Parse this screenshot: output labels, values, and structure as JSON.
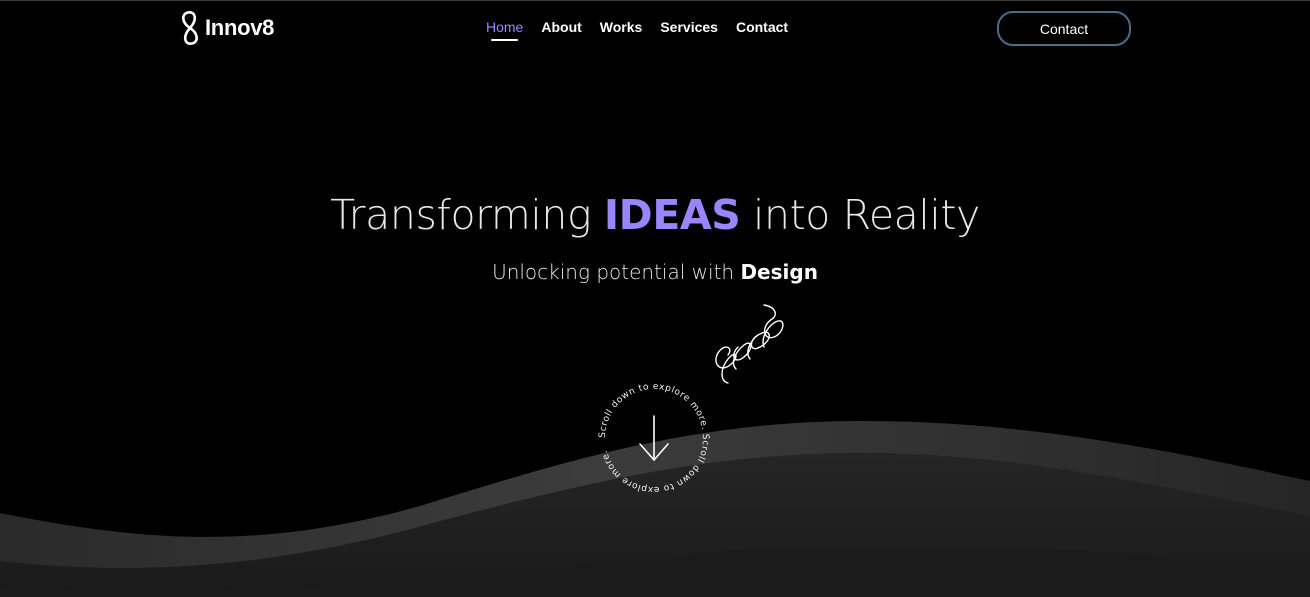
{
  "brand": {
    "name": "Innov8",
    "logo_icon": "infinity-8-icon"
  },
  "nav": {
    "items": [
      {
        "label": "Home",
        "active": true
      },
      {
        "label": "About",
        "active": false
      },
      {
        "label": "Works",
        "active": false
      },
      {
        "label": "Services",
        "active": false
      },
      {
        "label": "Contact",
        "active": false
      }
    ]
  },
  "header": {
    "cta_label": "Contact"
  },
  "hero": {
    "title_pre": "Transforming ",
    "title_accent": "IDEAS",
    "title_post": " into Reality",
    "subtitle_pre": "Unlocking potential with ",
    "subtitle_strong": "Design"
  },
  "scroll": {
    "ring_text": "Scroll down to explore more. Scroll down to explore more. ",
    "icon": "arrow-down-icon"
  },
  "colors": {
    "background": "#000000",
    "accent": "#9b85ff",
    "button_border": "#4a6d88",
    "wave_light": "#3a3a3a",
    "wave_dark": "#1e1e1e"
  }
}
